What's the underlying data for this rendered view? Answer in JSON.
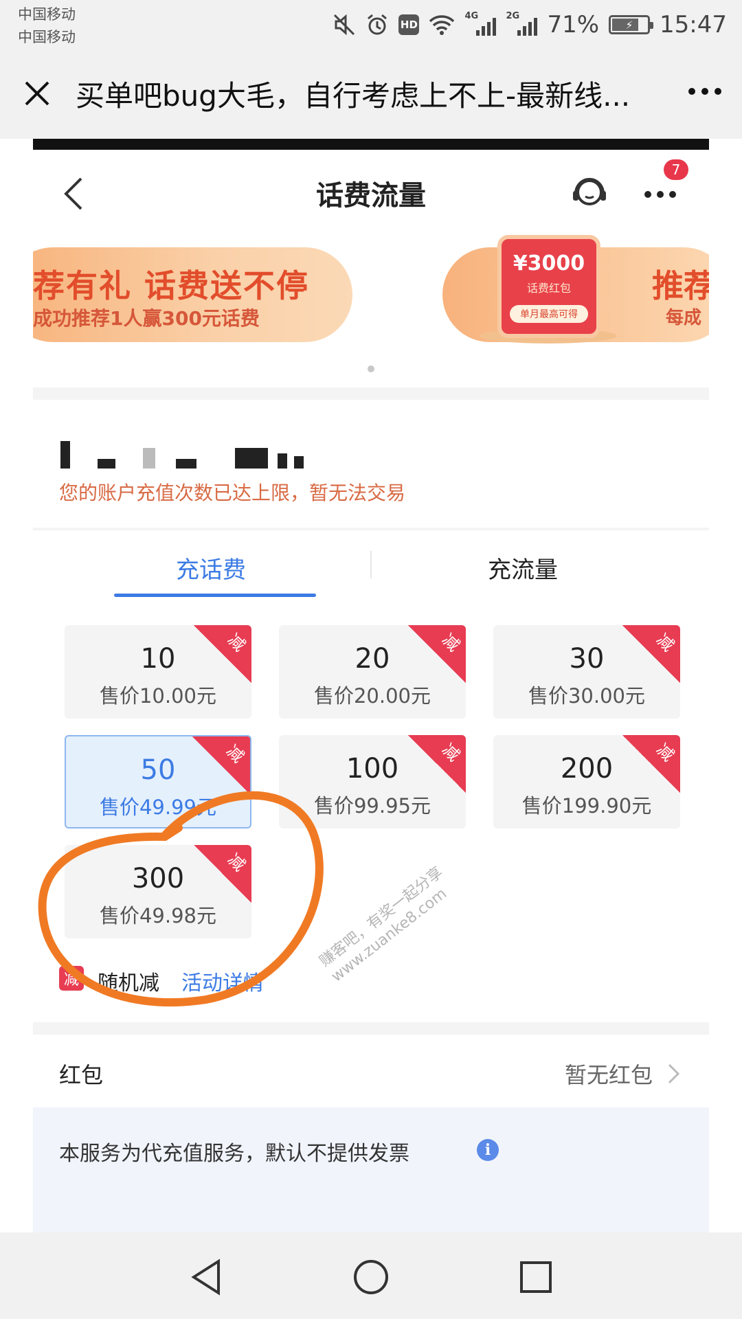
{
  "status_bar": {
    "carrier1": "中国移动",
    "carrier2": "中国移动",
    "hd": "HD",
    "net1": "4G",
    "net2": "2G",
    "battery_pct": "71%",
    "time": "15:47"
  },
  "titlebar": {
    "title": "买单吧bug大毛，自行考虑上不上-最新线..."
  },
  "page": {
    "title": "话费流量",
    "msg_badge": "7"
  },
  "banners": [
    {
      "main": "荐有礼  话费送不停",
      "sub": "成功推荐1人赢300元话费"
    },
    {
      "main": "推荐",
      "sub": "每成"
    }
  ],
  "redpack": {
    "amount": "¥3000",
    "sub": "话费红包",
    "cta": "单月最高可得"
  },
  "account": {
    "limit_msg": "您的账户充值次数已达上限，暂无法交易"
  },
  "tabs": [
    {
      "label": "充话费",
      "active": true
    },
    {
      "label": "充流量",
      "active": false
    }
  ],
  "denominations": [
    {
      "face": "10",
      "price": "售价10.00元",
      "tag": "减",
      "selected": false
    },
    {
      "face": "20",
      "price": "售价20.00元",
      "tag": "减",
      "selected": false
    },
    {
      "face": "30",
      "price": "售价30.00元",
      "tag": "减",
      "selected": false
    },
    {
      "face": "50",
      "price": "售价49.99元",
      "tag": "减",
      "selected": true
    },
    {
      "face": "100",
      "price": "售价99.95元",
      "tag": "减",
      "selected": false
    },
    {
      "face": "200",
      "price": "售价199.90元",
      "tag": "减",
      "selected": false
    },
    {
      "face": "300",
      "price": "售价49.98元",
      "tag": "减",
      "selected": false
    }
  ],
  "promo": {
    "icon": "减",
    "label": "随机减",
    "link": "活动详情"
  },
  "hongbao": {
    "label": "红包",
    "value": "暂无红包"
  },
  "notice": {
    "text": "本服务为代充值服务，默认不提供发票",
    "icon": "i"
  },
  "watermark": {
    "line1": "赚客吧，有奖一起分享",
    "line2": "www.zuanke8.com"
  },
  "colors": {
    "accent_blue": "#3c7be4",
    "tag_red": "#e73c52",
    "warning": "#d86a44",
    "annotation_orange": "#f07a24"
  }
}
